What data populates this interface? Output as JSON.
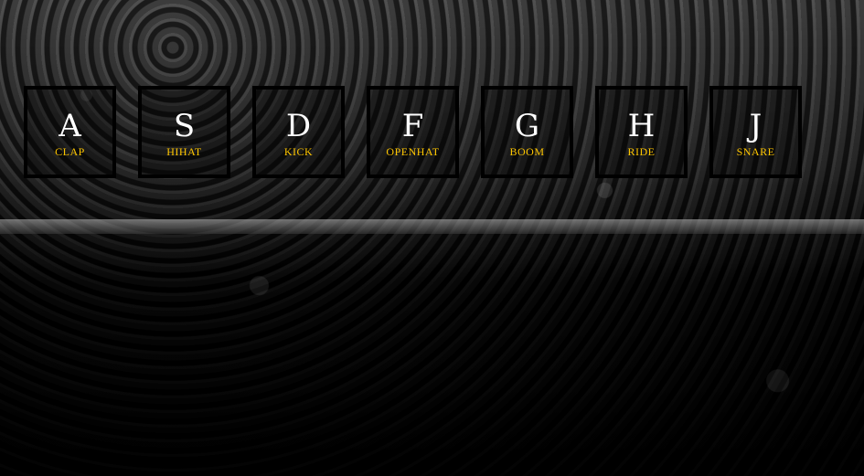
{
  "colors": {
    "key_border": "#000000",
    "key_letter": "#ffffff",
    "sound_label": "#ffc600"
  },
  "background": {
    "description_icon": "crowd-photo-background"
  },
  "keys": [
    {
      "letter": "A",
      "sound": "CLAP"
    },
    {
      "letter": "S",
      "sound": "HIHAT"
    },
    {
      "letter": "D",
      "sound": "KICK"
    },
    {
      "letter": "F",
      "sound": "OPENHAT"
    },
    {
      "letter": "G",
      "sound": "BOOM"
    },
    {
      "letter": "H",
      "sound": "RIDE"
    },
    {
      "letter": "J",
      "sound": "SNARE"
    }
  ]
}
